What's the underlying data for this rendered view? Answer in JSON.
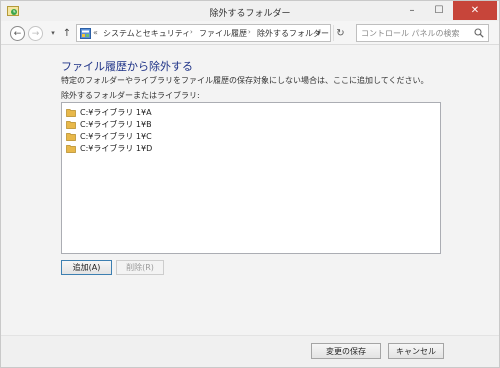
{
  "window": {
    "title": "除外するフォルダー"
  },
  "titlebar_buttons": {
    "minimize": "–",
    "maximize": "☐",
    "close": "✕"
  },
  "nav": {
    "back_glyph": "←",
    "forward_glyph": "→",
    "dropdown_glyph": "▾",
    "up_glyph": "↑",
    "address_prefix": "«",
    "breadcrumbs": [
      "システムとセキュリティ",
      "ファイル履歴",
      "除外するフォルダー"
    ],
    "crumb_separator": "›",
    "refresh_glyph": "↻",
    "search_placeholder": "コントロール パネルの検索"
  },
  "main": {
    "heading": "ファイル履歴から除外する",
    "description": "特定のフォルダーやライブラリをファイル履歴の保存対象にしない場合は、ここに追加してください。",
    "list_label": "除外するフォルダーまたはライブラリ:",
    "items": [
      "C:¥ライブラリ 1¥A",
      "C:¥ライブラリ 1¥B",
      "C:¥ライブラリ 1¥C",
      "C:¥ライブラリ 1¥D"
    ],
    "add_button": "追加(A)",
    "remove_button": "削除(R)"
  },
  "footer": {
    "save_button": "変更の保存",
    "cancel_button": "キャンセル"
  },
  "colors": {
    "heading": "#1e3287",
    "close_button": "#c7453a",
    "folder": "#e8b84a"
  }
}
